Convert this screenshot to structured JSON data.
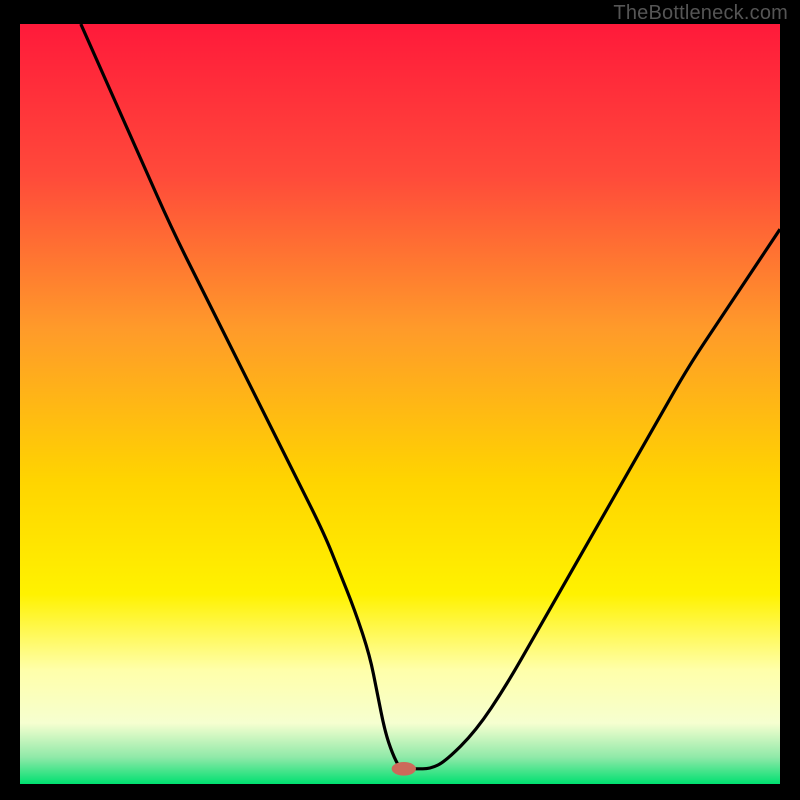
{
  "watermark": "TheBottleneck.com",
  "chart_data": {
    "type": "line",
    "title": "",
    "xlabel": "",
    "ylabel": "",
    "xlim": [
      0,
      100
    ],
    "ylim": [
      0,
      100
    ],
    "grid": false,
    "legend": false,
    "background_gradient": {
      "stops": [
        {
          "offset": 0.0,
          "color": "#ff1a3a"
        },
        {
          "offset": 0.2,
          "color": "#ff4a3a"
        },
        {
          "offset": 0.4,
          "color": "#ff9a2a"
        },
        {
          "offset": 0.6,
          "color": "#ffd400"
        },
        {
          "offset": 0.75,
          "color": "#fff200"
        },
        {
          "offset": 0.85,
          "color": "#ffffaa"
        },
        {
          "offset": 0.92,
          "color": "#f6ffd0"
        },
        {
          "offset": 0.965,
          "color": "#8fe9a8"
        },
        {
          "offset": 1.0,
          "color": "#00e070"
        }
      ]
    },
    "series": [
      {
        "name": "curve",
        "color": "#000000",
        "x": [
          8,
          12,
          16,
          20,
          24,
          28,
          32,
          36,
          40,
          42,
          44,
          46,
          47,
          48,
          49,
          50,
          51,
          52,
          54,
          56,
          60,
          64,
          68,
          72,
          76,
          80,
          84,
          88,
          92,
          96,
          100
        ],
        "y": [
          100,
          91,
          82,
          73,
          65,
          57,
          49,
          41,
          33,
          28,
          23,
          17,
          12,
          7,
          4,
          2,
          2,
          2,
          2,
          3,
          7,
          13,
          20,
          27,
          34,
          41,
          48,
          55,
          61,
          67,
          73
        ]
      }
    ],
    "marker": {
      "name": "bottleneck-marker",
      "x": 50.5,
      "y": 2,
      "rx": 1.6,
      "ry": 0.9,
      "color": "#cc6a5a"
    }
  }
}
